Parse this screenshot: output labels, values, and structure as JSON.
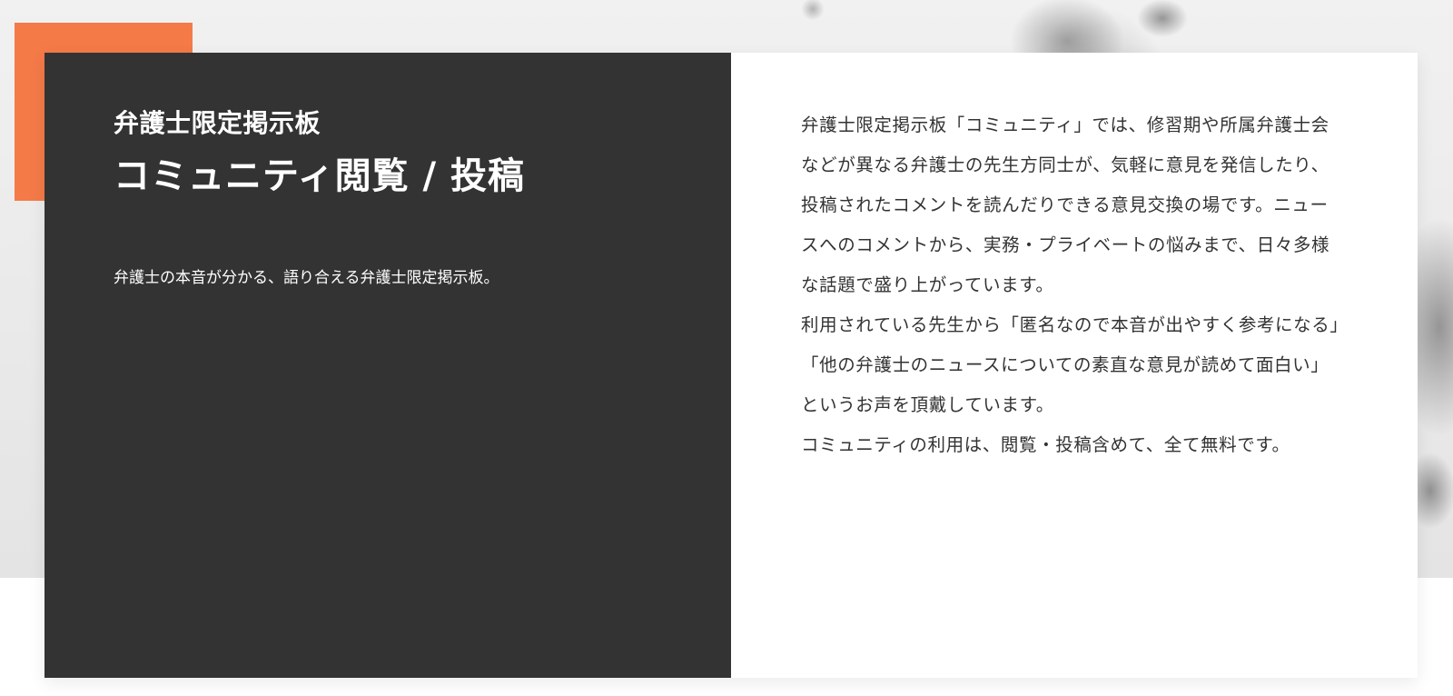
{
  "left_panel": {
    "eyebrow": "弁護士限定掲示板",
    "title": "コミュニティ閲覧 / 投稿",
    "tagline": "弁護士の本音が分かる、語り合える弁護士限定掲示板。"
  },
  "right_panel": {
    "paragraphs": [
      "弁護士限定掲示板「コミュニティ」では、修習期や所属弁護士会などが異なる弁護士の先生方同士が、気軽に意見を発信したり、投稿されたコメントを読んだりできる意見交換の場です。ニュースへのコメントから、実務・プライベートの悩みまで、日々多様な話題で盛り上がっています。",
      "利用されている先生から「匿名なので本音が出やすく参考になる」「他の弁護士のニュースについての素直な意見が読めて面白い」というお声を頂戴しています。",
      "コミュニティの利用は、閲覧・投稿含めて、全て無料です。"
    ]
  },
  "colors": {
    "accent": "#f47a48",
    "dark_panel": "#333333",
    "text_dark": "#333333",
    "text_light": "#ffffff"
  }
}
